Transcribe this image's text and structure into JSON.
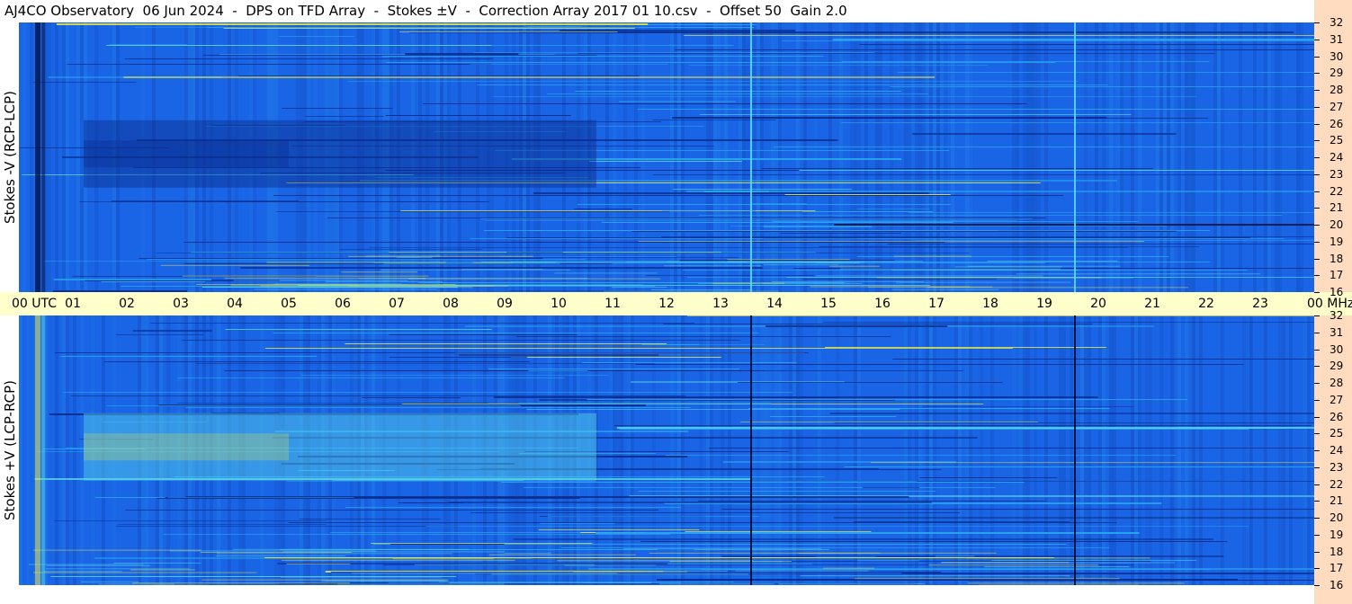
{
  "title": "AJ4CO Observatory  06 Jun 2024  -  DPS on TFD Array  -  Stokes ±V  -  Correction Array 2017 01 10.csv  -  Offset 50  Gain 2.0",
  "colors": {
    "base": "#1a64e6",
    "dark": "#0a2c8c",
    "light": "#2aa6ee",
    "cyan": "#5ad8e8",
    "yellow": "#e8e84a",
    "red": "#e85a3a",
    "time_axis_bg": "#ffffcc",
    "freq_axis_bg": "#ffdcc0"
  },
  "chart_data": [
    {
      "type": "heatmap",
      "panel": "top",
      "ylabel": "Stokes -V (RCP-LCP)",
      "x_range_utc_hours": [
        0,
        24
      ],
      "y_range_mhz": [
        16,
        32
      ],
      "vertical_line_utc": [
        13.55,
        19.55
      ],
      "vertical_line_style": "bright",
      "dark_band_utc": [
        1.2,
        10.7
      ],
      "dark_band_mhz": [
        22.2,
        26.2
      ]
    },
    {
      "type": "heatmap",
      "panel": "bottom",
      "ylabel": "Stokes +V (LCP-RCP)",
      "x_range_utc_hours": [
        0,
        24
      ],
      "y_range_mhz": [
        16,
        32
      ],
      "vertical_line_utc": [
        13.55,
        19.55
      ],
      "vertical_line_style": "dark",
      "bright_band_utc": [
        1.2,
        10.7
      ],
      "bright_band_mhz": [
        22.2,
        26.2
      ]
    }
  ],
  "time_axis": {
    "labels": [
      "00 UTC",
      "01",
      "02",
      "03",
      "04",
      "05",
      "06",
      "07",
      "08",
      "09",
      "10",
      "11",
      "12",
      "13",
      "14",
      "15",
      "16",
      "17",
      "18",
      "19",
      "20",
      "21",
      "22",
      "23",
      "00 MHz"
    ],
    "values": [
      0,
      1,
      2,
      3,
      4,
      5,
      6,
      7,
      8,
      9,
      10,
      11,
      12,
      13,
      14,
      15,
      16,
      17,
      18,
      19,
      20,
      21,
      22,
      23,
      24
    ]
  },
  "freq_axis": {
    "labels": [
      "32",
      "31",
      "30",
      "29",
      "28",
      "27",
      "26",
      "25",
      "24",
      "23",
      "22",
      "21",
      "20",
      "19",
      "18",
      "17",
      "16"
    ],
    "values": [
      32,
      31,
      30,
      29,
      28,
      27,
      26,
      25,
      24,
      23,
      22,
      21,
      20,
      19,
      18,
      17,
      16
    ]
  }
}
